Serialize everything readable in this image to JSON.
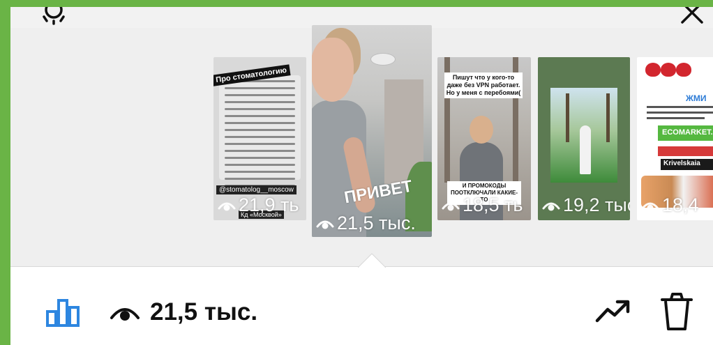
{
  "stories": [
    {
      "views": "21,9 ть",
      "caption": "Про стоматологию",
      "tag": "@stomatolog__moscow",
      "tag2": "Кд «Москвой»"
    },
    {
      "views": "21,5 тыс.",
      "overlay_text": "ПРИВЕТ",
      "selected": true
    },
    {
      "views": "18,5 ть",
      "caption": "Пишут что у кого-то даже без VPN работает. Но у меня с перебоями(",
      "caption2": "И ПРОМОКОДЫ ПООТКЛЮЧАЛИ КАКИЕ-ТО"
    },
    {
      "views": "19,2 тыс"
    },
    {
      "views": "18,4",
      "brand": "ЖМИ",
      "banner": "ECOMARKET.R",
      "banner2": "Krivelskaia"
    }
  ],
  "bottom_bar": {
    "views_text": "21,5 тыс."
  },
  "colors": {
    "accent": "#2d86e0",
    "frame": "#6ab446",
    "text": "#111111"
  },
  "icons": {
    "top_left": "gear-icon",
    "top_right": "close-icon",
    "stats": "bar-chart-icon",
    "views": "eye-icon",
    "promote": "trend-up-icon",
    "delete": "trash-icon"
  }
}
